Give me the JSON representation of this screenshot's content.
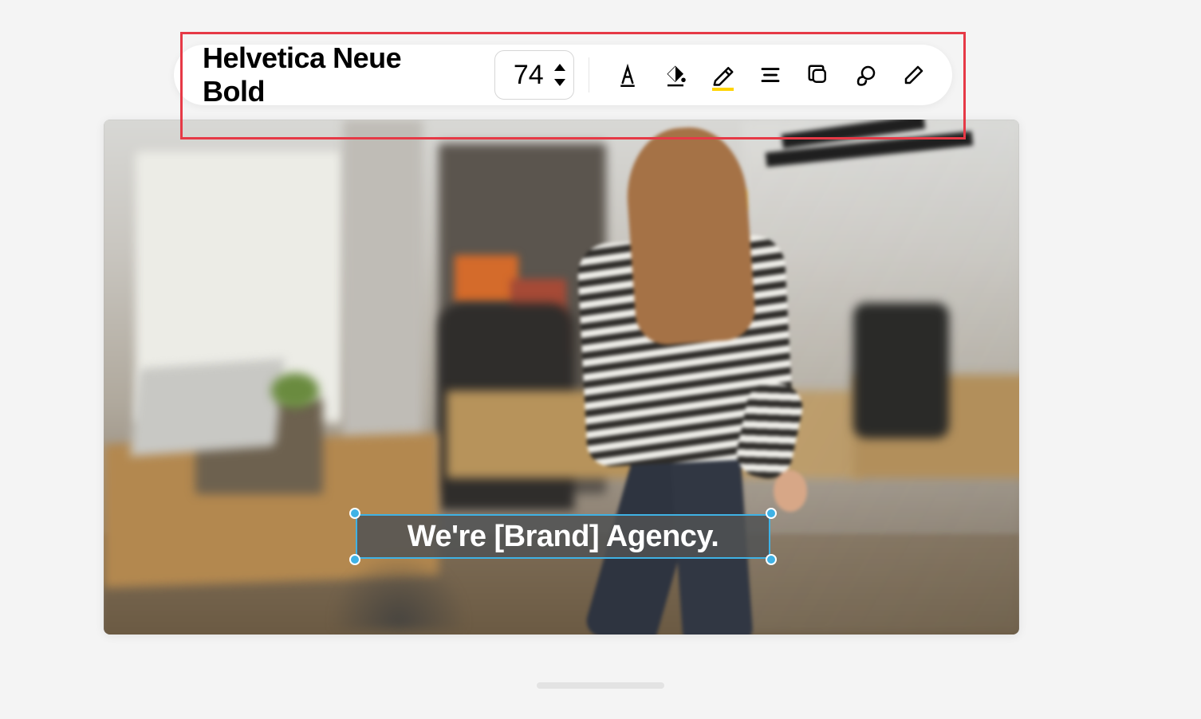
{
  "toolbar": {
    "fontName": "Helvetica Neue Bold",
    "fontSize": "74",
    "icons": {
      "textColor": "text-color-icon",
      "fillColor": "fill-color-icon",
      "highlighter": "highlighter-icon",
      "align": "align-icon",
      "layers": "layers-icon",
      "effects": "effects-icon",
      "edit": "edit-icon"
    }
  },
  "canvas": {
    "selectedText": "We're [Brand] Agency."
  },
  "highlightColor": "#ffd400"
}
